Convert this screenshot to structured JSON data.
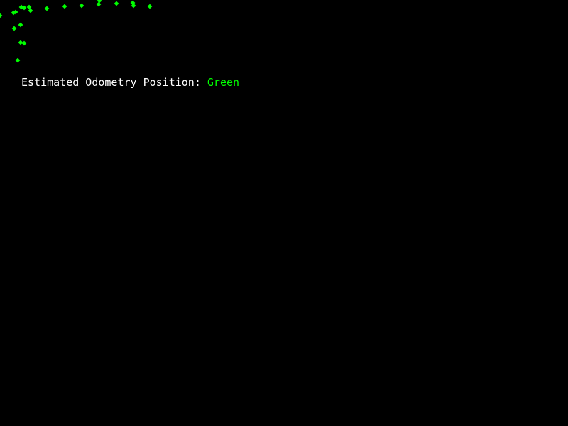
{
  "legend": {
    "label": "Estimated Odometry Position:",
    "color_name": "Green"
  },
  "colors": {
    "background": "#000000",
    "label_text": "#ffffff",
    "marker": "#00ff00"
  },
  "marker_shape": "diamond"
}
